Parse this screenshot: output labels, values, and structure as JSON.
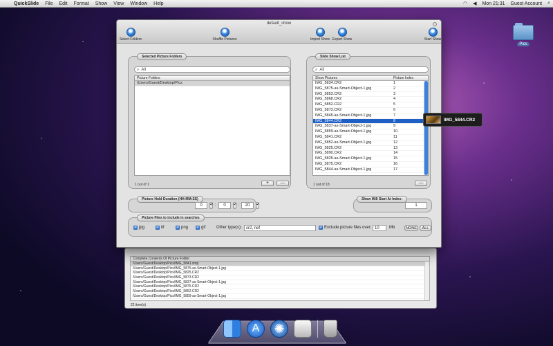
{
  "menubar": {
    "app": "QuickSlide",
    "items": [
      "File",
      "Edit",
      "Format",
      "Show",
      "View",
      "Window",
      "Help"
    ],
    "clock": "Mon 21:31",
    "user": "Guest Account"
  },
  "desktop": {
    "folder_label": "Pics"
  },
  "window": {
    "title": "default_show",
    "toolbar": {
      "select_folders": "Select Folders",
      "shuffle": "Shuffle Pictures",
      "import": "Import Show",
      "export": "Export Show",
      "start": "Start Show"
    },
    "selected_folders": {
      "label": "Selected Picture Folders",
      "search_placeholder": "All",
      "column": "Picture Folders",
      "rows": [
        "/Users/Guest/Desktop/Pics"
      ],
      "count": "1 out of 1",
      "add": "+",
      "remove": "—"
    },
    "slide_list": {
      "label": "Slide Show List",
      "search_placeholder": "All",
      "columns": [
        "Show Pictures",
        "Picture Index"
      ],
      "rows": [
        {
          "name": "IMG_5834.CR2",
          "index": "1"
        },
        {
          "name": "IMG_5875-as-Smart-Object-1.jpg",
          "index": "2"
        },
        {
          "name": "IMG_5853.CR2",
          "index": "3"
        },
        {
          "name": "IMG_5868.CR2",
          "index": "4"
        },
        {
          "name": "IMG_5852.CR2",
          "index": "5"
        },
        {
          "name": "IMG_5873.CR2",
          "index": "6"
        },
        {
          "name": "IMG_5845-as-Smart-Object-1.jpg",
          "index": "7"
        },
        {
          "name": "IMG_5844.CR2",
          "index": "8"
        },
        {
          "name": "IMG_5837-as-Smart-Object-1.jpg",
          "index": "9"
        },
        {
          "name": "IMG_5859-as-Smart-Object-1.jpg",
          "index": "10"
        },
        {
          "name": "IMG_5841.CR2",
          "index": "11"
        },
        {
          "name": "IMG_5852-as-Smart-Object-1.jpg",
          "index": "12"
        },
        {
          "name": "IMG_5825.CR2",
          "index": "13"
        },
        {
          "name": "IMG_5890.CR2",
          "index": "14"
        },
        {
          "name": "IMG_5825-as-Smart-Object-1.jpg",
          "index": "15"
        },
        {
          "name": "IMG_5875.CR2",
          "index": "16"
        },
        {
          "name": "IMG_5844-as-Smart-Object-1.jpg",
          "index": "17"
        }
      ],
      "selected_index": 7,
      "count": "1 out of 18",
      "remove": "—"
    },
    "hold_duration": {
      "label": "Picture Hold Duration (HH:MM:SS)",
      "hh": "0",
      "mm": "0",
      "ss": "20"
    },
    "start_index": {
      "label": "Show Will Start At Index:",
      "value": "1"
    },
    "file_types": {
      "label": "Picture Files to include in searches",
      "jpg": "jpg",
      "tif": "tif",
      "png": "png",
      "gif": "gif",
      "other_label": "Other type(s):",
      "other_value": "cr2, nef",
      "exclude_label": "Exclude picture files over:",
      "exclude_value": "10",
      "unit": "Mb",
      "none_btn": "NONE",
      "all_btn": "ALL"
    }
  },
  "tooltip": {
    "text": "IMG_5844.CR2"
  },
  "bg_window": {
    "header": "Complete Contents Of Picture Folder",
    "rows": [
      "/Users/Guest/Desktop/Pics/IMG_5841.xmp",
      "/Users/Guest/Desktop/Pics/IMG_5875-as-Smart-Object-1.jpg",
      "/Users/Guest/Desktop/Pics/IMG_5825.CR2",
      "/Users/Guest/Desktop/Pics/IMG_5873.CR2",
      "/Users/Guest/Desktop/Pics/IMG_5837-as-Smart-Object-1.jpg",
      "/Users/Guest/Desktop/Pics/IMG_5875.CR2",
      "/Users/Guest/Desktop/Pics/IMG_5852.CR2",
      "/Users/Guest/Desktop/Pics/IMG_5859-as-Smart-Object-1.jpg"
    ],
    "count": "22 item(s)"
  },
  "colors": {
    "selection": "#1e5fc6",
    "accent": "#3a8ee8"
  }
}
